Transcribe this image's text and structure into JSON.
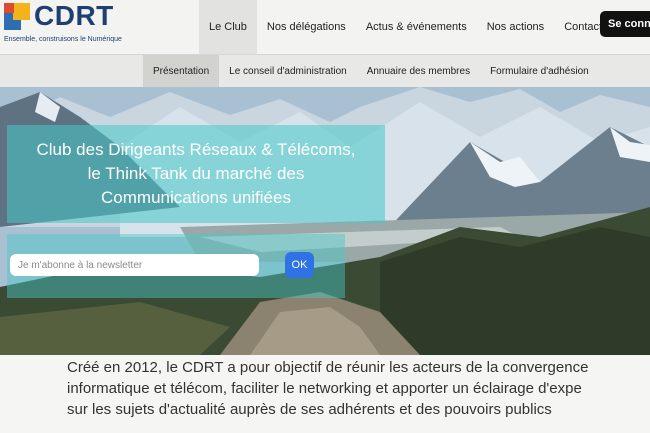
{
  "brand": {
    "name": "CDRT",
    "tagline": "Ensemble, construisons le Numérique",
    "colors": {
      "blue": "#2f6db3",
      "yellow": "#f4b31a",
      "red": "#e04a2f",
      "navy": "#1d3f72"
    }
  },
  "main_nav": {
    "items": [
      {
        "label": "Le Club",
        "active": true
      },
      {
        "label": "Nos délégations",
        "active": false
      },
      {
        "label": "Actus & événements",
        "active": false
      },
      {
        "label": "Nos actions",
        "active": false
      },
      {
        "label": "Contact",
        "active": false
      }
    ],
    "login_label": "Se conn"
  },
  "sub_nav": {
    "items": [
      {
        "label": "Présentation",
        "active": true
      },
      {
        "label": "Le conseil d'administration",
        "active": false
      },
      {
        "label": "Annuaire des membres",
        "active": false
      },
      {
        "label": "Formulaire d'adhésion",
        "active": false
      }
    ]
  },
  "hero": {
    "title_lines": [
      "Club des Dirigeants Réseaux & Télécoms,",
      "le Think Tank du marché des",
      "Communications unifiées"
    ],
    "newsletter": {
      "placeholder": "Je m'abonne à la newsletter",
      "value": "",
      "button_label": "OK"
    },
    "accent_color": "#2f72e6"
  },
  "intro": {
    "lines": [
      "Créé en 2012, le CDRT a pour objectif de réunir les acteurs de la convergence",
      "informatique et télécom, faciliter le networking et apporter un éclairage d'expe",
      "sur les sujets d'actualité auprès de ses adhérents et des pouvoirs publics"
    ]
  }
}
